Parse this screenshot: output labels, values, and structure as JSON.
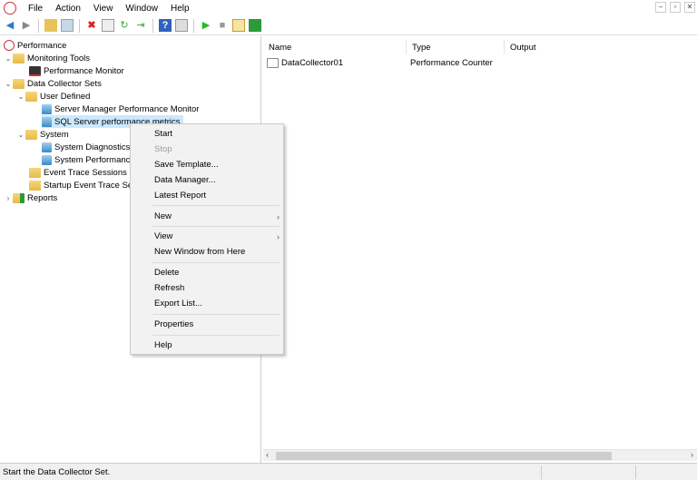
{
  "menubar": {
    "items": [
      "File",
      "Action",
      "View",
      "Window",
      "Help"
    ]
  },
  "tree": {
    "root": "Performance",
    "monitoring_tools": "Monitoring Tools",
    "performance_monitor": "Performance Monitor",
    "data_collector_sets": "Data Collector Sets",
    "user_defined": "User Defined",
    "server_manager": "Server Manager Performance Monitor",
    "sql_server": "SQL Server performance metrics",
    "system": "System",
    "system_diagnostics": "System Diagnostics",
    "system_performance": "System Performance",
    "event_trace": "Event Trace Sessions",
    "startup_event_trace": "Startup Event Trace Sessions",
    "reports": "Reports"
  },
  "list": {
    "columns": [
      "Name",
      "Type",
      "Output"
    ],
    "rows": [
      {
        "name": "DataCollector01",
        "type": "Performance Counter",
        "output": ""
      }
    ]
  },
  "context_menu": {
    "start": "Start",
    "stop": "Stop",
    "save_template": "Save Template...",
    "data_manager": "Data Manager...",
    "latest_report": "Latest Report",
    "new": "New",
    "view": "View",
    "new_window": "New Window from Here",
    "delete": "Delete",
    "refresh": "Refresh",
    "export_list": "Export List...",
    "properties": "Properties",
    "help": "Help",
    "submenu_arrow": "›"
  },
  "status": {
    "text": "Start the Data Collector Set."
  }
}
